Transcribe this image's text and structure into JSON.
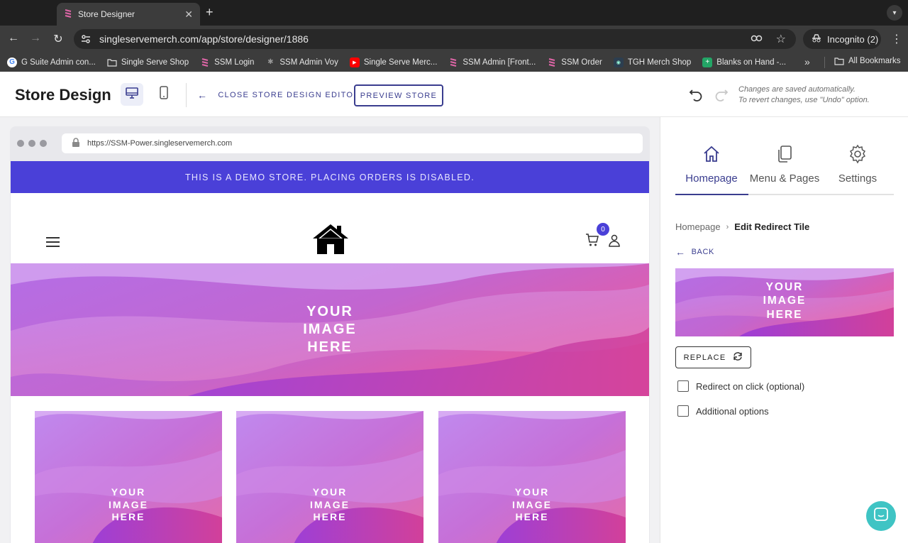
{
  "browser": {
    "tab_title": "Store Designer",
    "url": "singleservemerch.com/app/store/designer/1886",
    "incognito_label": "Incognito (2)",
    "bookmarks": [
      {
        "label": "G Suite Admin con...",
        "icon": "google-icon"
      },
      {
        "label": "Single Serve Shop",
        "icon": "folder-icon"
      },
      {
        "label": "SSM Login",
        "icon": "ssm-logo-icon"
      },
      {
        "label": "SSM Admin Voy",
        "icon": "gear-logo-icon"
      },
      {
        "label": "Single Serve Merc...",
        "icon": "youtube-icon"
      },
      {
        "label": "SSM Admin [Front...",
        "icon": "ssm-logo-icon"
      },
      {
        "label": "SSM Order",
        "icon": "ssm-logo-icon"
      },
      {
        "label": "TGH Merch Shop",
        "icon": "tgh-logo-icon"
      },
      {
        "label": "Blanks on Hand -...",
        "icon": "sheets-icon"
      }
    ],
    "all_bookmarks_label": "All Bookmarks"
  },
  "header": {
    "title": "Store Design",
    "close_editor_label": "CLOSE STORE DESIGN EDITOR",
    "preview_label": "PREVIEW STORE",
    "autosave_line1": "Changes are saved automatically.",
    "autosave_line2": "To revert changes, use \"Undo\" option."
  },
  "preview": {
    "url": "https://SSM-Power.singleservemerch.com",
    "demo_banner": "THIS IS A DEMO STORE. PLACING ORDERS IS DISABLED.",
    "cart_count": "0",
    "hero_text": [
      "YOUR",
      "IMAGE",
      "HERE"
    ],
    "tile_text": [
      "YOUR",
      "IMAGE",
      "HERE"
    ]
  },
  "panel": {
    "tabs": [
      {
        "label": "Homepage",
        "icon": "home-icon",
        "active": true
      },
      {
        "label": "Menu & Pages",
        "icon": "pages-icon",
        "active": false
      },
      {
        "label": "Settings",
        "icon": "gear-icon",
        "active": false
      }
    ],
    "breadcrumb_root": "Homepage",
    "breadcrumb_current": "Edit Redirect Tile",
    "back_label": "BACK",
    "image_text": [
      "YOUR",
      "IMAGE",
      "HERE"
    ],
    "replace_label": "REPLACE",
    "redirect_label": "Redirect on click (optional)",
    "redirect_checked": false,
    "additional_label": "Additional options",
    "additional_checked": false
  },
  "colors": {
    "accent": "#3a3d8f",
    "demo_banner": "#4a40d8",
    "chat_fab": "#3fc4c4"
  }
}
